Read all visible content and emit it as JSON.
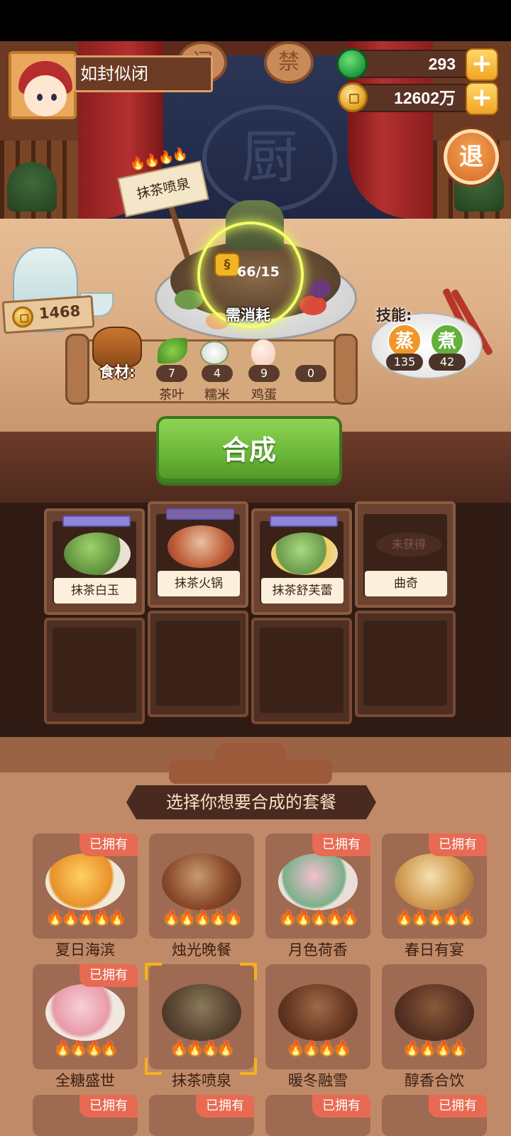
{
  "player": {
    "name": "如封似闭"
  },
  "currency": {
    "jade": "293",
    "coins": "12602万"
  },
  "exit_label": "退",
  "scene": {
    "plaque_left": "闲",
    "plaque_right": "禁",
    "emblem": "厨"
  },
  "current_dish": {
    "name": "抹茶喷泉",
    "cost": "66/15",
    "cost_label": "需消耗",
    "flames": "🔥🔥🔥🔥"
  },
  "tip_coins": "1468",
  "skills": {
    "label": "技能:",
    "items": [
      {
        "name": "蒸",
        "count": "135",
        "color": "#f0962a"
      },
      {
        "name": "煮",
        "count": "42",
        "color": "#63b03a"
      }
    ]
  },
  "ingredients": {
    "label": "食材:",
    "items": [
      {
        "name": "茶叶",
        "count": "7",
        "icon": "tea-leaf-icon"
      },
      {
        "name": "糯米",
        "count": "4",
        "icon": "rice-icon"
      },
      {
        "name": "鸡蛋",
        "count": "9",
        "icon": "egg-icon"
      },
      {
        "name": "",
        "count": "0",
        "icon": "empty-icon"
      }
    ]
  },
  "craft_label": "合成",
  "shelf": [
    {
      "name": "抹茶白玉",
      "unlocked": true
    },
    {
      "name": "抹茶火锅",
      "unlocked": true
    },
    {
      "name": "抹茶舒芙蕾",
      "unlocked": true
    },
    {
      "name": "曲奇",
      "unlocked": false,
      "locked_text": "未获得"
    }
  ],
  "selector": {
    "title": "选择你想要合成的套餐",
    "owned_label": "已拥有",
    "sets": [
      {
        "name": "夏日海滨",
        "owned": true,
        "flames": 5
      },
      {
        "name": "烛光晚餐",
        "owned": false,
        "flames": 5
      },
      {
        "name": "月色荷香",
        "owned": true,
        "flames": 5
      },
      {
        "name": "春日有宴",
        "owned": true,
        "flames": 5
      },
      {
        "name": "全糖盛世",
        "owned": true,
        "flames": 4
      },
      {
        "name": "抹茶喷泉",
        "owned": false,
        "flames": 4,
        "selected": true
      },
      {
        "name": "暖冬融雪",
        "owned": false,
        "flames": 4
      },
      {
        "name": "醇香合饮",
        "owned": false,
        "flames": 4
      }
    ],
    "next_row_owned": [
      "已拥有",
      "已拥有",
      "已拥有",
      "已拥有"
    ]
  }
}
